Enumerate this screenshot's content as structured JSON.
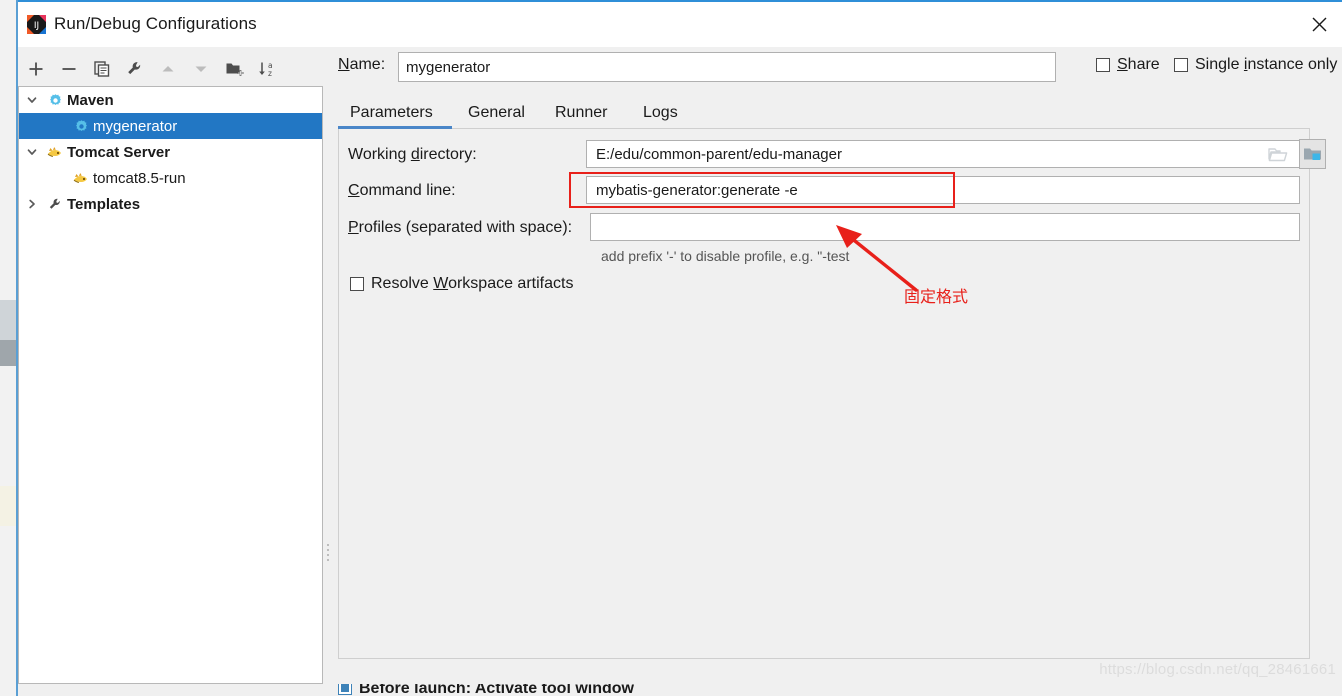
{
  "window": {
    "title": "Run/Debug Configurations",
    "app_icon": "intellij-idea-icon",
    "close_label": "✕"
  },
  "toolbar": {
    "buttons": [
      {
        "name": "add-configuration-button",
        "icon": "plus-icon",
        "enabled": true
      },
      {
        "name": "remove-configuration-button",
        "icon": "minus-icon",
        "enabled": true
      },
      {
        "name": "copy-configuration-button",
        "icon": "copy-icon",
        "enabled": true
      },
      {
        "name": "edit-templates-button",
        "icon": "wrench-icon",
        "enabled": true
      },
      {
        "name": "move-up-button",
        "icon": "arrow-up-icon",
        "enabled": false
      },
      {
        "name": "move-down-button",
        "icon": "arrow-down-icon",
        "enabled": false
      },
      {
        "name": "create-folder-button",
        "icon": "folder-add-icon",
        "enabled": true
      },
      {
        "name": "sort-configurations-button",
        "icon": "sort-az-icon",
        "enabled": true
      }
    ]
  },
  "tree": {
    "items": [
      {
        "label": "Maven",
        "icon": "maven-gear-icon",
        "twisty": "chevron-down-icon",
        "level": 0,
        "bold": true,
        "selected": false
      },
      {
        "label": "mygenerator",
        "icon": "maven-gear-icon",
        "twisty": "none",
        "level": 1,
        "bold": false,
        "selected": true
      },
      {
        "label": "Tomcat Server",
        "icon": "tomcat-cat-icon",
        "twisty": "chevron-down-icon",
        "level": 0,
        "bold": true,
        "selected": false
      },
      {
        "label": "tomcat8.5-run",
        "icon": "tomcat-cat-icon",
        "twisty": "none",
        "level": 1,
        "bold": false,
        "selected": false
      },
      {
        "label": "Templates",
        "icon": "wrench-icon",
        "twisty": "chevron-right-icon",
        "level": 0,
        "bold": true,
        "selected": false
      }
    ]
  },
  "header": {
    "name_label": "Name:",
    "name_mnemonic": "N",
    "name_value": "mygenerator",
    "share_label": "Share",
    "share_mnemonic": "S",
    "share_checked": false,
    "single_instance_label": "Single instance only",
    "single_instance_mnemonic": "i",
    "single_instance_checked": false
  },
  "tabs": {
    "items": [
      {
        "label": "Parameters",
        "active": true
      },
      {
        "label": "General",
        "active": false
      },
      {
        "label": "Runner",
        "active": false
      },
      {
        "label": "Logs",
        "active": false
      }
    ],
    "active_index": 0,
    "active_underline_color": "#4a86c8"
  },
  "parameters": {
    "working_directory_label": "Working directory:",
    "working_directory_mnemonic": "d",
    "working_directory_value": "E:/edu/common-parent/edu-manager",
    "browse_icon": "folder-open-icon",
    "module_icon": "folder-module-icon",
    "command_line_label": "Command line:",
    "command_line_mnemonic": "C",
    "command_line_value": "mybatis-generator:generate -e",
    "profiles_label": "Profiles (separated with space):",
    "profiles_mnemonic": "P",
    "profiles_value": "",
    "profiles_placeholder": "",
    "profiles_hint": "add prefix '-' to disable profile, e.g. \"-test",
    "resolve_workspace_label": "Resolve Workspace artifacts",
    "resolve_workspace_mnemonic": "W",
    "resolve_workspace_checked": false
  },
  "annotations": {
    "highlight_color": "#e8201a",
    "note_text": "固定格式",
    "highlighted_field": "command_line"
  },
  "bottom": {
    "before_launch_label": "Before launch: Activate tool window",
    "before_launch_checked": true
  },
  "watermark": {
    "text": "https://blog.csdn.net/qq_28461661"
  }
}
